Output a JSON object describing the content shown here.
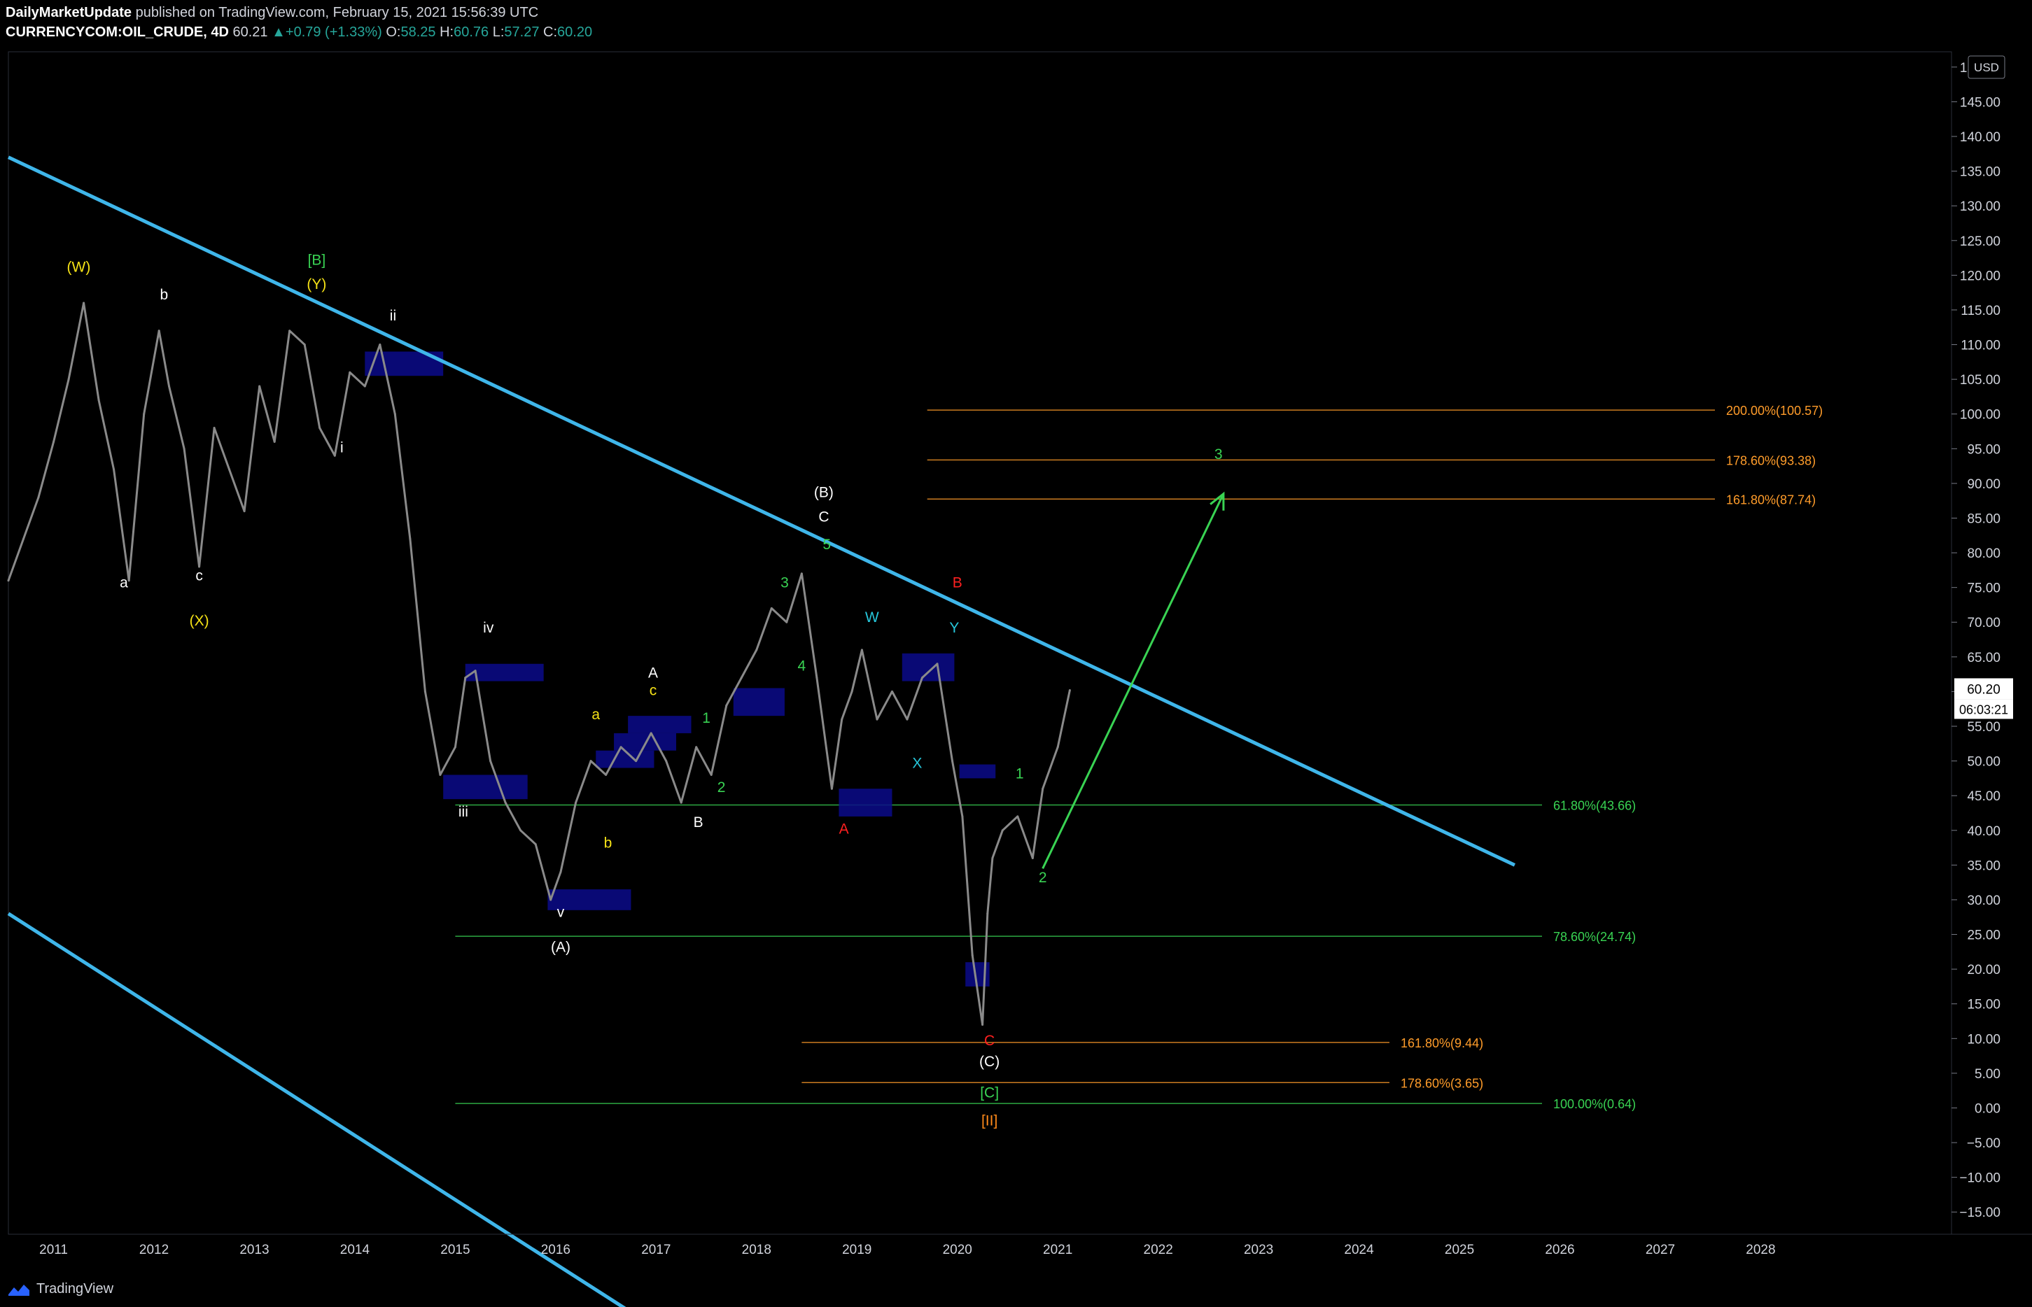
{
  "header": {
    "author": "DailyMarketUpdate",
    "published_text": "published on TradingView.com, February 15, 2021 15:56:39 UTC",
    "symbol": "CURRENCYCOM:OIL_CRUDE, 4D",
    "last": "60.21",
    "change": "+0.79 (+1.33%)",
    "o_label": "O:",
    "o": "58.25",
    "h_label": "H:",
    "h": "60.76",
    "l_label": "L:",
    "l": "57.27",
    "c_label": "C:",
    "c": "60.20"
  },
  "footer": {
    "brand": "TradingView"
  },
  "colors": {
    "background": "#000000",
    "axis_text": "#d1d4dc",
    "price": "#8a8a8a",
    "channel": "#3fb6ea",
    "fib_green": "#39d353",
    "fib_orange": "#ff9c2a",
    "box": "#0a0a8a",
    "white_label": "#ffffff",
    "yellow_label": "#f5e216",
    "green_label": "#39d353",
    "cyan_label": "#26c6da",
    "red_label": "#ff2020",
    "orange_label": "#ff8a1a"
  },
  "chart_data": {
    "type": "line",
    "title": "",
    "xlabel": "",
    "ylabel": "",
    "currency": "USD",
    "ylim": [
      -18,
      152
    ],
    "xlim": [
      2010.55,
      2029.9
    ],
    "yticks": [
      150,
      145,
      140,
      135,
      130,
      125,
      120,
      115,
      110,
      105,
      100,
      95,
      90,
      85,
      80,
      75,
      70,
      65,
      60,
      55,
      50,
      45,
      40,
      35,
      30,
      25,
      20,
      15,
      10,
      5,
      0,
      -5,
      -10,
      -15
    ],
    "ytick_labels": [
      "150.00",
      "145.00",
      "140.00",
      "135.00",
      "130.00",
      "125.00",
      "120.00",
      "115.00",
      "110.00",
      "105.00",
      "100.00",
      "95.00",
      "90.00",
      "85.00",
      "80.00",
      "75.00",
      "70.00",
      "65.00",
      "60.00",
      "55.00",
      "50.00",
      "45.00",
      "40.00",
      "35.00",
      "30.00",
      "25.00",
      "20.00",
      "15.00",
      "10.00",
      "5.00",
      "0.00",
      "−5.00",
      "−10.00",
      "−15.00"
    ],
    "xticks": [
      2011,
      2012,
      2013,
      2014,
      2015,
      2016,
      2017,
      2018,
      2019,
      2020,
      2021,
      2022,
      2023,
      2024,
      2025,
      2026,
      2027,
      2028
    ],
    "xtick_labels": [
      "2011",
      "2012",
      "2013",
      "2014",
      "2015",
      "2016",
      "2017",
      "2018",
      "2019",
      "2020",
      "2021",
      "2022",
      "2023",
      "2024",
      "2025",
      "2026",
      "2027",
      "2028"
    ],
    "last_price_label": "60.20",
    "countdown_label": "06:03:21",
    "last_price": 60.2,
    "series": [
      {
        "x": [
          2010.55,
          2010.7,
          2010.85,
          2011.0,
          2011.15,
          2011.3,
          2011.45,
          2011.6,
          2011.75,
          2011.9,
          2012.05,
          2012.15,
          2012.3,
          2012.45,
          2012.6,
          2012.75,
          2012.9,
          2013.05,
          2013.2,
          2013.35,
          2013.5,
          2013.65,
          2013.8,
          2013.95,
          2014.1,
          2014.25,
          2014.4,
          2014.55,
          2014.7,
          2014.85,
          2015.0,
          2015.1,
          2015.2,
          2015.35,
          2015.5,
          2015.65,
          2015.8,
          2015.95,
          2016.05,
          2016.2,
          2016.35,
          2016.5,
          2016.65,
          2016.8,
          2016.95,
          2017.1,
          2017.25,
          2017.4,
          2017.55,
          2017.7,
          2017.85,
          2018.0,
          2018.15,
          2018.3,
          2018.45,
          2018.6,
          2018.75,
          2018.85,
          2018.95,
          2019.05,
          2019.2,
          2019.35,
          2019.5,
          2019.65,
          2019.8,
          2019.95,
          2020.05,
          2020.15,
          2020.25,
          2020.3,
          2020.35,
          2020.45,
          2020.6,
          2020.75,
          2020.85,
          2021.0,
          2021.12
        ],
        "values": [
          76,
          82,
          88,
          96,
          105,
          116,
          102,
          92,
          76,
          100,
          112,
          104,
          95,
          78,
          98,
          92,
          86,
          104,
          96,
          112,
          110,
          98,
          94,
          106,
          104,
          110,
          100,
          82,
          60,
          48,
          52,
          62,
          63,
          50,
          44,
          40,
          38,
          30,
          34,
          44,
          50,
          48,
          52,
          50,
          54,
          50,
          44,
          52,
          48,
          58,
          62,
          66,
          72,
          70,
          77,
          62,
          46,
          56,
          60,
          66,
          56,
          60,
          56,
          62,
          64,
          50,
          42,
          22,
          12,
          28,
          36,
          40,
          42,
          36,
          46,
          52,
          60.2
        ]
      }
    ],
    "fib_levels": [
      {
        "label": "200.00%(100.57)",
        "value": 100.57,
        "color": "orange"
      },
      {
        "label": "178.60%(93.38)",
        "value": 93.38,
        "color": "orange"
      },
      {
        "label": "161.80%(87.74)",
        "value": 87.74,
        "color": "orange"
      },
      {
        "label": "61.80%(43.66)",
        "value": 43.66,
        "color": "green"
      },
      {
        "label": "78.60%(24.74)",
        "value": 24.74,
        "color": "green"
      },
      {
        "label": "161.80%(9.44)",
        "value": 9.44,
        "color": "orange"
      },
      {
        "label": "178.60%(3.65)",
        "value": 3.65,
        "color": "orange"
      },
      {
        "label": "100.00%(0.64)",
        "value": 0.64,
        "color": "green"
      }
    ],
    "wave_labels": [
      {
        "text": "(W)",
        "x": 2011.25,
        "y": 120.5,
        "color": "yellow"
      },
      {
        "text": "b",
        "x": 2012.1,
        "y": 116.5,
        "color": "white"
      },
      {
        "text": "[B]",
        "x": 2013.62,
        "y": 121.5,
        "color": "green"
      },
      {
        "text": "(Y)",
        "x": 2013.62,
        "y": 118.0,
        "color": "yellow"
      },
      {
        "text": "ii",
        "x": 2014.38,
        "y": 113.5,
        "color": "white"
      },
      {
        "text": "a",
        "x": 2011.7,
        "y": 75.0,
        "color": "white"
      },
      {
        "text": "c",
        "x": 2012.45,
        "y": 76.0,
        "color": "white"
      },
      {
        "text": "(X)",
        "x": 2012.45,
        "y": 69.5,
        "color": "yellow"
      },
      {
        "text": "i",
        "x": 2013.87,
        "y": 94.5,
        "color": "white"
      },
      {
        "text": "iv",
        "x": 2015.33,
        "y": 68.5,
        "color": "white"
      },
      {
        "text": "iii",
        "x": 2015.08,
        "y": 42.0,
        "color": "white"
      },
      {
        "text": "v",
        "x": 2016.05,
        "y": 27.5,
        "color": "white"
      },
      {
        "text": "(A)",
        "x": 2016.05,
        "y": 22.5,
        "color": "white"
      },
      {
        "text": "a",
        "x": 2016.4,
        "y": 56.0,
        "color": "yellow"
      },
      {
        "text": "b",
        "x": 2016.52,
        "y": 37.5,
        "color": "yellow"
      },
      {
        "text": "A",
        "x": 2016.97,
        "y": 62.0,
        "color": "white"
      },
      {
        "text": "c",
        "x": 2016.97,
        "y": 59.5,
        "color": "yellow"
      },
      {
        "text": "1",
        "x": 2017.5,
        "y": 55.5,
        "color": "green"
      },
      {
        "text": "2",
        "x": 2017.65,
        "y": 45.5,
        "color": "green"
      },
      {
        "text": "B",
        "x": 2017.42,
        "y": 40.5,
        "color": "white"
      },
      {
        "text": "3",
        "x": 2018.28,
        "y": 75.0,
        "color": "green"
      },
      {
        "text": "4",
        "x": 2018.45,
        "y": 63.0,
        "color": "green"
      },
      {
        "text": "(B)",
        "x": 2018.67,
        "y": 88.0,
        "color": "white"
      },
      {
        "text": "C",
        "x": 2018.67,
        "y": 84.5,
        "color": "white"
      },
      {
        "text": "5",
        "x": 2018.7,
        "y": 80.5,
        "color": "green"
      },
      {
        "text": "W",
        "x": 2019.15,
        "y": 70.0,
        "color": "cyan"
      },
      {
        "text": "B",
        "x": 2020.0,
        "y": 75.0,
        "color": "red"
      },
      {
        "text": "Y",
        "x": 2019.97,
        "y": 68.5,
        "color": "cyan"
      },
      {
        "text": "X",
        "x": 2019.6,
        "y": 49.0,
        "color": "cyan"
      },
      {
        "text": "A",
        "x": 2018.87,
        "y": 39.5,
        "color": "red"
      },
      {
        "text": "1",
        "x": 2020.62,
        "y": 47.5,
        "color": "green"
      },
      {
        "text": "2",
        "x": 2020.85,
        "y": 32.5,
        "color": "green"
      },
      {
        "text": "3",
        "x": 2022.6,
        "y": 93.5,
        "color": "green"
      },
      {
        "text": "C",
        "x": 2020.32,
        "y": 9.0,
        "color": "red"
      },
      {
        "text": "(C)",
        "x": 2020.32,
        "y": 6.0,
        "color": "white"
      },
      {
        "text": "[C]",
        "x": 2020.32,
        "y": 1.5,
        "color": "green"
      },
      {
        "text": "[II]",
        "x": 2020.32,
        "y": -2.5,
        "color": "orange"
      }
    ],
    "channel_lines": [
      {
        "x": [
          2010.55,
          2025.55
        ],
        "y": [
          137.0,
          35.0
        ]
      },
      {
        "x": [
          2010.55,
          2017.35
        ],
        "y": [
          28.0,
          -35.0
        ]
      }
    ],
    "projection_arrow": {
      "x": [
        2020.85,
        2022.65
      ],
      "y": [
        34.5,
        88.5
      ]
    },
    "zones": [
      {
        "x": [
          2014.1,
          2014.88
        ],
        "y": [
          105.5,
          109.0
        ]
      },
      {
        "x": [
          2015.1,
          2015.88
        ],
        "y": [
          61.5,
          64.0
        ]
      },
      {
        "x": [
          2014.88,
          2015.72
        ],
        "y": [
          44.5,
          48.0
        ]
      },
      {
        "x": [
          2016.72,
          2017.35
        ],
        "y": [
          54.0,
          56.5
        ]
      },
      {
        "x": [
          2016.4,
          2016.98
        ],
        "y": [
          49.0,
          51.5
        ]
      },
      {
        "x": [
          2016.58,
          2017.2
        ],
        "y": [
          51.5,
          54.0
        ]
      },
      {
        "x": [
          2017.77,
          2018.28
        ],
        "y": [
          56.5,
          60.5
        ]
      },
      {
        "x": [
          2015.92,
          2016.75
        ],
        "y": [
          28.5,
          31.5
        ]
      },
      {
        "x": [
          2018.82,
          2019.35
        ],
        "y": [
          42.0,
          46.0
        ]
      },
      {
        "x": [
          2019.45,
          2019.97
        ],
        "y": [
          61.5,
          65.5
        ]
      },
      {
        "x": [
          2020.02,
          2020.38
        ],
        "y": [
          47.5,
          49.5
        ]
      },
      {
        "x": [
          2020.08,
          2020.32
        ],
        "y": [
          17.5,
          21.0
        ]
      }
    ]
  }
}
